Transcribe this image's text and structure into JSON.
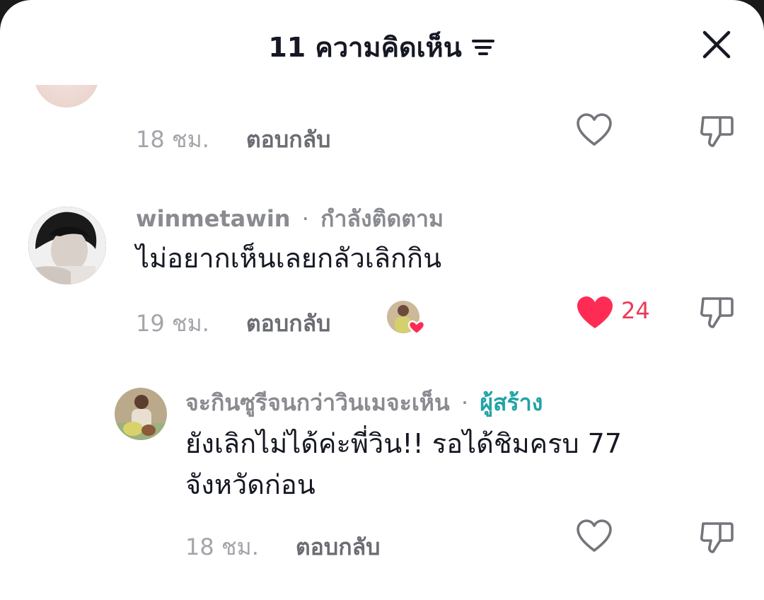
{
  "header": {
    "title": "11 ความคิดเห็น",
    "sort_icon": "sort-lines-icon",
    "close_icon": "close-icon"
  },
  "comments": [
    {
      "time": "18 ชม.",
      "reply_label": "ตอบกลับ",
      "liked": false
    },
    {
      "username": "winmetawin",
      "separator": "·",
      "badge": "กำลังติดตาม",
      "text": "ไม่อยากเห็นเลยกลัวเลิกกิน",
      "time": "19 ชม.",
      "reply_label": "ตอบกลับ",
      "liked": true,
      "like_count": "24",
      "liked_by_creator": true
    }
  ],
  "reply": {
    "username": "จะกินซูรีจนกว่าวินเมจะเห็น",
    "separator": "·",
    "badge": "ผู้สร้าง",
    "text_line1": "ยังเลิกไม่ได้ค่ะพี่วิน!! รอได้ชิมครบ 77",
    "text_line2": "จังหวัดก่อน",
    "time": "18 ชม.",
    "reply_label": "ตอบกลับ",
    "liked": false
  },
  "colors": {
    "liked_heart": "#fe2c55",
    "creator_badge": "#20a3a6",
    "text_primary": "#161823",
    "text_secondary": "#a3a5ab"
  }
}
